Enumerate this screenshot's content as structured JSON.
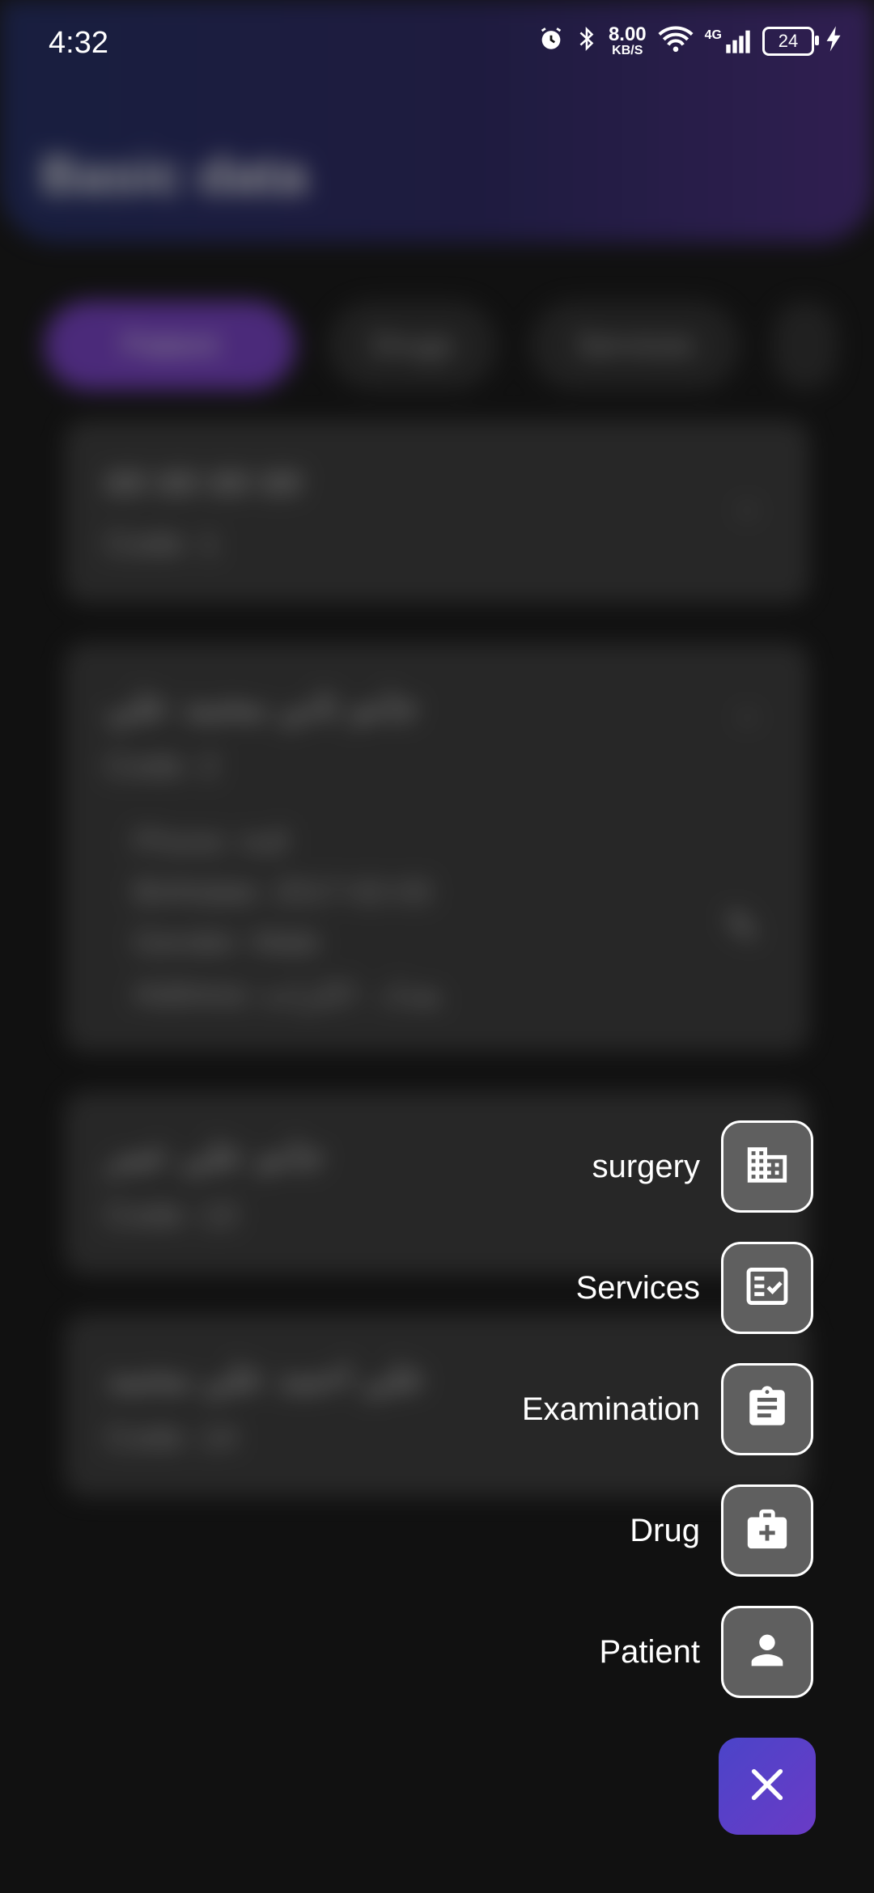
{
  "status_bar": {
    "time": "4:32",
    "net_speed": "8.00",
    "net_speed_unit": "KB/S",
    "network": "4G",
    "battery": "24"
  },
  "background": {
    "title": "Basic data",
    "chips": [
      "Patient",
      "Drugs",
      "Services",
      ""
    ],
    "cards": [
      {
        "name": "## ## ## ##",
        "code": "Code: 1"
      },
      {
        "name": "جانم ثاني محمد علي",
        "code": "Code: 2",
        "details": [
          "Phone: null",
          "Birthdate: 2017-02-03",
          "Gender: Male",
          "Address: بغداد - الكرادة"
        ]
      },
      {
        "name": "جانم علي عمر",
        "code": "Code: 13"
      },
      {
        "name": "علي احمد علي محمد",
        "code": "Code: 14"
      }
    ]
  },
  "speed_dial": {
    "items": [
      {
        "label": "surgery",
        "icon": "building-icon"
      },
      {
        "label": "Services",
        "icon": "checklist-icon"
      },
      {
        "label": "Examination",
        "icon": "clipboard-icon"
      },
      {
        "label": "Drug",
        "icon": "medical-bag-icon"
      },
      {
        "label": "Patient",
        "icon": "person-icon"
      }
    ],
    "close_icon": "close-icon"
  },
  "colors": {
    "background": "#111111",
    "header_gradient_start": "#1f2a66",
    "header_gradient_end": "#4a2b86",
    "active_chip": "#7b3fd0",
    "dial_button": "#5f5f5f",
    "fab": "#5a3fc8"
  }
}
